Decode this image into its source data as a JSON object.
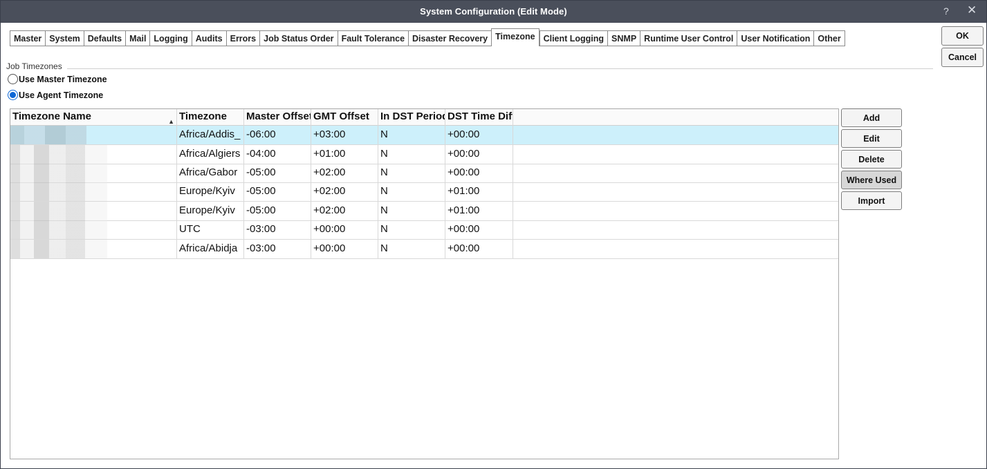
{
  "window": {
    "title": "System Configuration (Edit Mode)",
    "help_label": "?",
    "close_label": "✕"
  },
  "tabs": [
    {
      "label": "Master"
    },
    {
      "label": "System"
    },
    {
      "label": "Defaults"
    },
    {
      "label": "Mail"
    },
    {
      "label": "Logging"
    },
    {
      "label": "Audits"
    },
    {
      "label": "Errors"
    },
    {
      "label": "Job Status Order"
    },
    {
      "label": "Fault Tolerance"
    },
    {
      "label": "Disaster Recovery"
    },
    {
      "label": "Timezone",
      "active": true
    },
    {
      "label": "Client Logging"
    },
    {
      "label": "SNMP"
    },
    {
      "label": "Runtime User Control"
    },
    {
      "label": "User Notification"
    },
    {
      "label": "Other"
    }
  ],
  "dialog_buttons": {
    "ok": "OK",
    "cancel": "Cancel"
  },
  "section": {
    "label": "Job Timezones"
  },
  "radios": {
    "master": {
      "label": "Use Master Timezone",
      "checked": false
    },
    "agent": {
      "label": "Use Agent Timezone",
      "checked": true
    }
  },
  "table": {
    "columns": [
      "Timezone Name",
      "Timezone",
      "Master Offset",
      "GMT Offset",
      "In DST Period",
      "DST Time Diff"
    ],
    "sort_indicator": "▲",
    "rows": [
      {
        "name": "",
        "timezone": "Africa/Addis_",
        "master_offset": "-06:00",
        "gmt_offset": "+03:00",
        "in_dst": "N",
        "dst_diff": "+00:00",
        "selected": true
      },
      {
        "name": "",
        "timezone": "Africa/Algiers",
        "master_offset": "-04:00",
        "gmt_offset": "+01:00",
        "in_dst": "N",
        "dst_diff": "+00:00"
      },
      {
        "name": "",
        "timezone": "Africa/Gabor",
        "master_offset": "-05:00",
        "gmt_offset": "+02:00",
        "in_dst": "N",
        "dst_diff": "+00:00"
      },
      {
        "name": "",
        "timezone": "Europe/Kyiv",
        "master_offset": "-05:00",
        "gmt_offset": "+02:00",
        "in_dst": "N",
        "dst_diff": "+01:00"
      },
      {
        "name": "",
        "timezone": "Europe/Kyiv",
        "master_offset": "-05:00",
        "gmt_offset": "+02:00",
        "in_dst": "N",
        "dst_diff": "+01:00"
      },
      {
        "name": "",
        "timezone": "UTC",
        "master_offset": "-03:00",
        "gmt_offset": "+00:00",
        "in_dst": "N",
        "dst_diff": "+00:00"
      },
      {
        "name": "",
        "timezone": "Africa/Abidja",
        "master_offset": "-03:00",
        "gmt_offset": "+00:00",
        "in_dst": "N",
        "dst_diff": "+00:00"
      }
    ]
  },
  "actions": {
    "add": "Add",
    "edit": "Edit",
    "delete": "Delete",
    "where_used": "Where Used",
    "import": "Import"
  },
  "colors": {
    "titlebar": "#4a4f5b",
    "selected_row": "#cdf0fb",
    "radio_accent": "#0a66d6"
  }
}
